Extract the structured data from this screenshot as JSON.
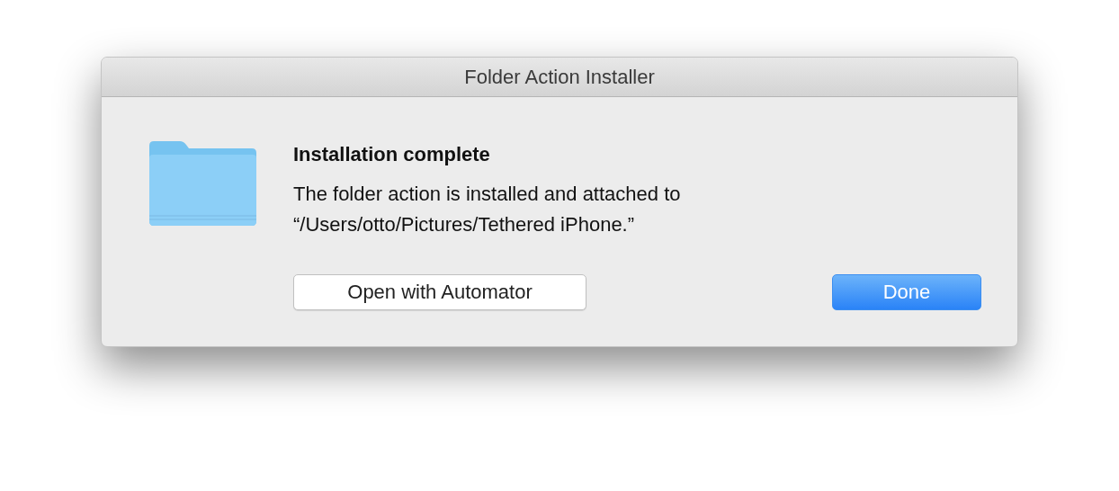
{
  "window": {
    "title": "Folder Action Installer"
  },
  "dialog": {
    "heading": "Installation complete",
    "message": "The folder action is installed and attached to “/Users/otto/Pictures/Tethered iPhone.”"
  },
  "buttons": [
    {
      "label": "Open with Automator",
      "kind": "normal"
    },
    {
      "label": "Done",
      "kind": "default"
    }
  ]
}
